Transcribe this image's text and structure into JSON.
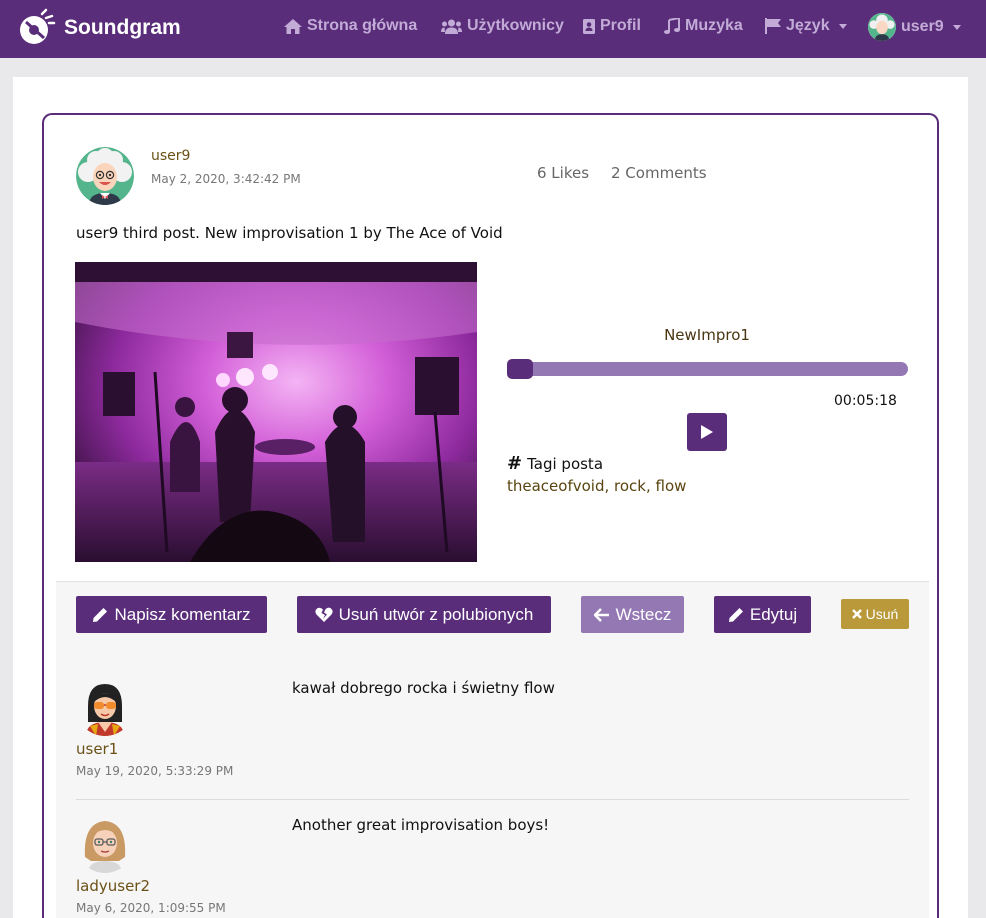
{
  "brand": {
    "name": "Soundgram"
  },
  "nav": {
    "home": "Strona główna",
    "users": "Użytkownicy",
    "profile": "Profil",
    "music": "Muzyka",
    "language": "Język",
    "user": "user9"
  },
  "post": {
    "author": "user9",
    "date": "May 2, 2020, 3:42:42 PM",
    "likes": "6 Likes",
    "comments": "2 Comments",
    "text": "user9 third post. New improvisation 1 by The Ace of Void"
  },
  "player": {
    "title": "NewImpro1",
    "time": "00:05:18",
    "progress": 0
  },
  "tags": {
    "heading": "Tagi posta",
    "list": "theaceofvoid, rock, flow"
  },
  "actions": {
    "comment": "Napisz komentarz",
    "unlike": "Usuń utwór z polubionych",
    "back": "Wstecz",
    "edit": "Edytuj",
    "delete": "Usuń"
  },
  "comments": [
    {
      "author": "user1",
      "date": "May 19, 2020, 5:33:29 PM",
      "text": "kawał dobrego rocka i świetny flow"
    },
    {
      "author": "ladyuser2",
      "date": "May 6, 2020, 1:09:55 PM",
      "text": "Another great improvisation boys!"
    }
  ],
  "colors": {
    "primary": "#5a2d7a",
    "secondary": "#9478b4",
    "warning": "#b9993a",
    "author_text": "#6b5116"
  }
}
